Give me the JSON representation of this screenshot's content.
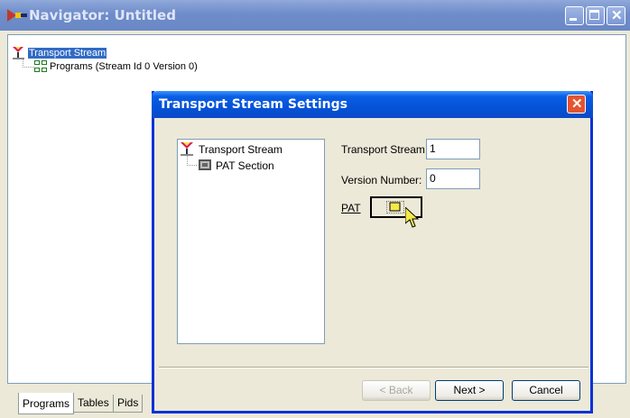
{
  "window": {
    "title": "Navigator: Untitled"
  },
  "tree": {
    "root": "Transport Stream",
    "child": "Programs (Stream Id 0 Version 0)"
  },
  "tabs": [
    "Programs",
    "Tables",
    "Pids"
  ],
  "dialog": {
    "title": "Transport Stream Settings",
    "tree_root": "Transport Stream",
    "tree_child": "PAT Section",
    "transport_stream_label": "Transport Stream:",
    "transport_stream_value": "1",
    "version_number_label": "Version Number:",
    "version_number_value": "0",
    "pat_label": "PAT",
    "buttons": {
      "back": "< Back",
      "next": "Next >",
      "cancel": "Cancel"
    }
  },
  "colors": {
    "dialog_titlebar": "#0553d8",
    "selection": "#316ac5",
    "close_button": "#e5532f"
  },
  "icons": [
    "app-icon",
    "minimize-icon",
    "maximize-icon",
    "close-icon",
    "transport-stream-icon",
    "programs-icon",
    "pat-section-icon",
    "pat-open-icon",
    "cursor-icon"
  ]
}
